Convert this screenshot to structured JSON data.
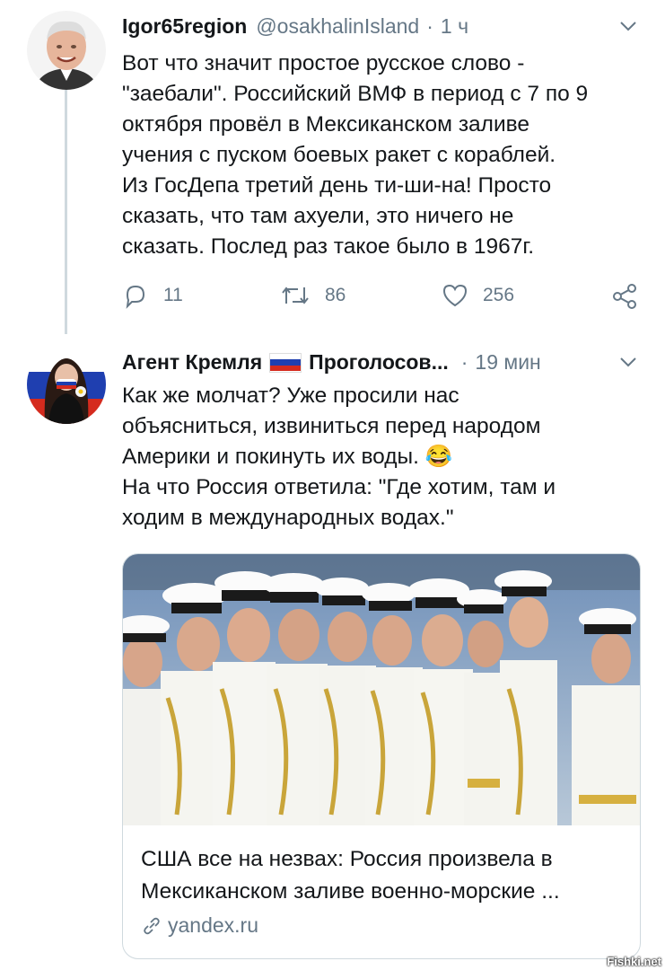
{
  "tweet1": {
    "name": "Igor65region",
    "handle": "@osakhalinIsland",
    "separator": "·",
    "time": "1 ч",
    "lines": [
      "Вот что значит простое русское слово -",
      "\"заебали\". Российский ВМФ в период с 7 по 9",
      "октября провёл в Мексиканском заливе",
      "учения  с пуском боевых ракет с кораблей.",
      "Из ГосДепа третий день ти-ши-на! Просто",
      "сказать, что там ахуели, это ничего не",
      "сказать. Послед раз такое было в 1967г."
    ],
    "replies": "11",
    "retweets": "86",
    "likes": "256"
  },
  "tweet2": {
    "name_part1": "Агент Кремля",
    "name_part2": "Проголосов...",
    "separator": "·",
    "time": "19 мин",
    "lines": [
      "Как же молчат? Уже просили нас",
      "объясниться, извиниться перед народом",
      "Америки и покинуть их воды. 😂",
      "На что Россия ответила: \"Где хотим, там и",
      "ходим в международных водах.\""
    ],
    "card": {
      "title_lines": [
        "США все на незвах: Россия произвела в",
        "Мексиканском заливе военно-морские ..."
      ],
      "domain": "yandex.ru"
    }
  },
  "icons": {
    "chevron": "chevron-down-icon",
    "reply": "reply-icon",
    "retweet": "retweet-icon",
    "like": "heart-icon",
    "share": "share-icon",
    "link": "link-icon"
  },
  "colors": {
    "text": "#14171a",
    "secondary": "#657786",
    "border": "#cfd9de",
    "flag_white": "#ffffff",
    "flag_blue": "#1f3fb0",
    "flag_red": "#d52b1e"
  },
  "watermark": "Fishki.net"
}
